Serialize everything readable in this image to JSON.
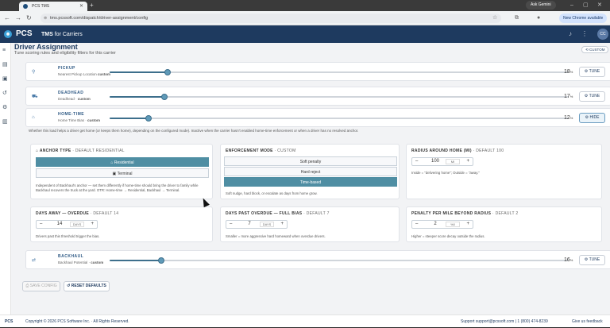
{
  "browser": {
    "tab_title": "PCS TMS",
    "url": "tms.pcssoft.com/dispatch/driver-assignment/config",
    "ask_gemini": "Ask Gemini",
    "profile_button": "New Chrome available"
  },
  "app": {
    "logo_text": "PCS",
    "product_prefix": "TMS",
    "product_suffix": "for Carriers",
    "avatar": "CC"
  },
  "page": {
    "title": "Driver Assignment",
    "subtitle": "Tune scoring rules and eligibility filters for this carrier",
    "custom_badge": "CUSTOM"
  },
  "rules": [
    {
      "name": "PICKUP",
      "desc_prefix": "Nearest Pickup Location",
      "desc_suffix": "custom",
      "value": "18",
      "unit": "%",
      "button": "TUNE",
      "fill": 0.18
    },
    {
      "name": "DEADHEAD",
      "desc_prefix": "Deadhead ·",
      "desc_suffix": "custom",
      "value": "17",
      "unit": "%",
      "button": "TUNE",
      "fill": 0.17
    },
    {
      "name": "HOME-TIME",
      "desc_prefix": "Home Time Bias ·",
      "desc_suffix": "custom",
      "value": "12",
      "unit": "%",
      "button": "HIDE",
      "fill": 0.12
    },
    {
      "name": "BACKHAUL",
      "desc_prefix": "Backhaul Potential ·",
      "desc_suffix": "custom",
      "value": "16",
      "unit": "%",
      "button": "TUNE",
      "fill": 0.16
    }
  ],
  "home_time": {
    "help": "Whether this load helps a driver get home (or keeps them home), depending on the configured mode). Inactive when the carrier hasn't enabled home-time enforcement or when a driver has no resolved anchor.",
    "anchor": {
      "label": "ANCHOR TYPE",
      "default": "· DEFAULT RESIDENTIAL",
      "options": [
        "Residential",
        "Terminal"
      ],
      "selected": "Residential",
      "desc": "Independent of Backhaul's anchor — set them differently if home-time should bring the driver to family while Backhaul recovers the truck at the yard. OTR: Home-time → Residential, Backhaul → Terminal."
    },
    "enforcement": {
      "label": "ENFORCEMENT MODE",
      "default": "· CUSTOM",
      "options": [
        "Soft penalty",
        "Hard reject",
        "Time-based"
      ],
      "selected": "Time-based",
      "desc": "Soft nudge, hard block, or escalate as days from home grow."
    },
    "radius": {
      "label": "RADIUS AROUND HOME (MI)",
      "default": "· DEFAULT 100",
      "value": "100",
      "unit": "MI",
      "desc": "Inside = \"delivering home\"; Outside = \"away.\""
    },
    "days_away": {
      "label": "DAYS AWAY — OVERDUE",
      "default": "· DEFAULT 14",
      "value": "14",
      "unit": "DAYS",
      "desc": "Drivers past this threshold trigger the bias."
    },
    "days_past": {
      "label": "DAYS PAST OVERDUE — FULL BIAS",
      "default": "· DEFAULT 7",
      "value": "7",
      "unit": "DAYS",
      "desc": "Smaller = more aggressive hard homeward when overdue drivers."
    },
    "penalty": {
      "label": "PENALTY PER MILE BEYOND RADIUS",
      "default": "· DEFAULT 2",
      "value": "2",
      "unit": "%0",
      "desc": "Higher = steeper score decay outside the radius."
    }
  },
  "actions": {
    "save": "SAVE CONFIG",
    "reset": "RESET DEFAULTS"
  },
  "footer": {
    "logo": "PCS",
    "copyright": "Copyright © 2026 PCS Software Inc. · All Rights Reserved.",
    "support": "Support support@pcssoft.com | 1 (800) 474-8239",
    "feedback": "Give us feedback"
  }
}
